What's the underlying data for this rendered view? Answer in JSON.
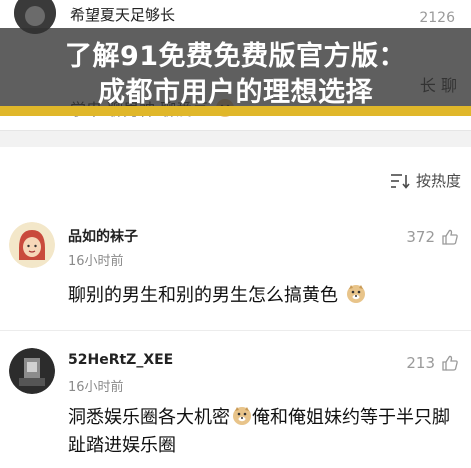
{
  "banner": {
    "line1": "了解91免费免费版官方版：",
    "line2": "成都市用户的理想选择"
  },
  "top_comment": {
    "username": "希望夏天足够长",
    "likes": "2126",
    "text": "学串 聊男神 聊爱豆",
    "right_fragment": "长 聊"
  },
  "sort": {
    "label": "按热度",
    "icon": "sort-icon"
  },
  "comments": [
    {
      "username": "品如的袜子",
      "time": "16小时前",
      "likes": "372",
      "text": "聊别的男生和别的男生怎么搞黄色",
      "avatar_icon": "cartoon-girl-avatar",
      "emoji": "doge-emoji"
    },
    {
      "username": "52HeRtZ_XEE",
      "time": "16小时前",
      "likes": "213",
      "text_part1": "洞悉娱乐圈各大机密",
      "text_part2": "俺和俺姐妹约等于半只脚趾踏进娱乐圈",
      "avatar_icon": "dark-photo-avatar",
      "emoji": "doge-emoji"
    }
  ],
  "colors": {
    "banner_bg": "#323232",
    "banner_accent": "#e0b72a",
    "muted_text": "#9a9a9a"
  }
}
